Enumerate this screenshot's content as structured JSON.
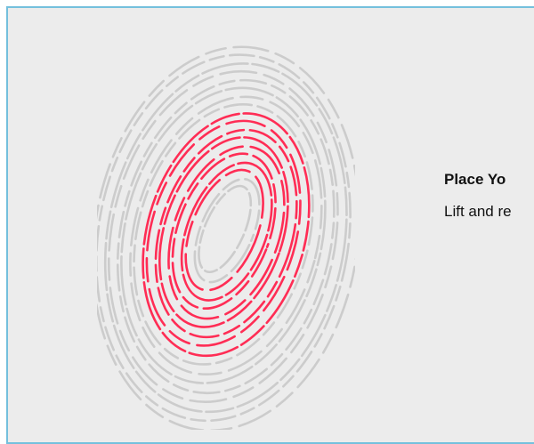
{
  "window": {
    "border_color": "#74c0dd",
    "background": "#ececec"
  },
  "fingerprint": {
    "icon": "fingerprint-icon",
    "ridge_color": "#cccccc",
    "captured_color": "#ff2d55"
  },
  "instructions": {
    "title": "Place Yo",
    "subtitle": "Lift and re"
  }
}
